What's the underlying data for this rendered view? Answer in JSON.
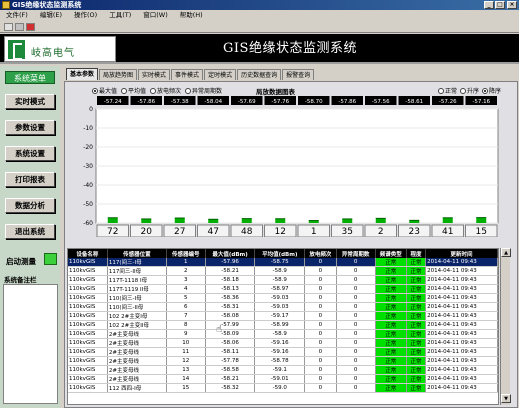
{
  "window": {
    "title": "GIS绝缘状态监测系统"
  },
  "menubar": [
    "文件(F)",
    "编辑(E)",
    "操作(O)",
    "工具(T)",
    "窗口(W)",
    "帮助(H)"
  ],
  "header": {
    "company": "岐高电气",
    "app_title": "GIS绝缘状态监测系统"
  },
  "sidebar": {
    "menu_title": "系统菜单",
    "buttons": [
      "实时模式",
      "参数设置",
      "系统设置",
      "打印报表",
      "数据分析",
      "退出系统"
    ],
    "start_label": "启动测量",
    "notes_label": "系统备注栏"
  },
  "tabs": [
    "基本参数",
    "局放趋势图",
    "实时模式",
    "事件模式",
    "定时模式",
    "历史数据查询",
    "报警查询"
  ],
  "radios": [
    "最大值",
    "平均值",
    "放电频次",
    "异常周期数"
  ],
  "sort_radios": [
    "正常",
    "升序",
    "降序"
  ],
  "chart_title": "局放数据图表",
  "chart_data": {
    "type": "bar",
    "categories": [
      "72",
      "20",
      "27",
      "47",
      "48",
      "12",
      "1",
      "35",
      "2",
      "23",
      "41",
      "15"
    ],
    "top_labels": [
      "-57.24",
      "-57.86",
      "-57.38",
      "-58.04",
      "-57.69",
      "-57.76",
      "-58.70",
      "-57.86",
      "-57.56",
      "-58.61",
      "-57.26",
      "-57.16"
    ],
    "values": [
      -57.24,
      -57.86,
      -57.38,
      -58.04,
      -57.69,
      -57.76,
      -58.7,
      -57.86,
      -57.56,
      -58.61,
      -57.26,
      -57.16
    ],
    "yticks": [
      "0",
      "-10",
      "-20",
      "-30",
      "-40",
      "-50",
      "-60"
    ],
    "ylim": [
      -60,
      0
    ],
    "bar_color": "#00b000"
  },
  "table": {
    "headers": [
      "设备名称",
      "传感器位置",
      "传感器编号",
      "最大值(dBm)",
      "平均值(dBm)",
      "放电频次",
      "异常周期数",
      "频谱类型",
      "程度",
      "更新时间"
    ],
    "rows": [
      [
        "110kvGIS",
        "117(间三-I母",
        "1",
        "-57.96",
        "-58.75",
        "0",
        "0",
        "正常",
        "正常",
        "2014-04-11 09:43"
      ],
      [
        "110kvGIS",
        "117间三-II母",
        "2",
        "-58.21",
        "-58.9",
        "0",
        "0",
        "正常",
        "正常",
        "2014-04-11 09:43"
      ],
      [
        "110kvGIS",
        "117T-1118 I母",
        "3",
        "-58.18",
        "-58.9",
        "0",
        "0",
        "正常",
        "正常",
        "2014-04-11 09:43"
      ],
      [
        "110kvGIS",
        "117T-1119 II母",
        "4",
        "-58.13",
        "-58.97",
        "0",
        "0",
        "正常",
        "正常",
        "2014-04-11 09:43"
      ],
      [
        "110kvGIS",
        "110(间三-I母",
        "5",
        "-58.36",
        "-59.03",
        "0",
        "0",
        "正常",
        "正常",
        "2014-04-11 09:43"
      ],
      [
        "110kvGIS",
        "110(间三-II母",
        "6",
        "-58.31",
        "-59.03",
        "0",
        "0",
        "正常",
        "正常",
        "2014-04-11 09:43"
      ],
      [
        "110kvGIS",
        "102 2#主变I母",
        "7",
        "-58.08",
        "-59.17",
        "0",
        "0",
        "正常",
        "正常",
        "2014-04-11 09:43"
      ],
      [
        "110kvGIS",
        "102 2#主变II母",
        "8",
        "-57.99",
        "-58.99",
        "0",
        "0",
        "正常",
        "正常",
        "2014-04-11 09:43"
      ],
      [
        "110kvGIS",
        "2#主变母线",
        "9",
        "-58.09",
        "-58.9",
        "0",
        "0",
        "正常",
        "正常",
        "2014-04-11 09:43"
      ],
      [
        "110kvGIS",
        "2#主变母线",
        "10",
        "-58.06",
        "-59.16",
        "0",
        "0",
        "正常",
        "正常",
        "2014-04-11 09:43"
      ],
      [
        "110kvGIS",
        "2#主变母线",
        "11",
        "-58.11",
        "-59.16",
        "0",
        "0",
        "正常",
        "正常",
        "2014-04-11 09:43"
      ],
      [
        "110kvGIS",
        "2#主变母线",
        "12",
        "-57.78",
        "-58.78",
        "0",
        "0",
        "正常",
        "正常",
        "2014-04-11 09:43"
      ],
      [
        "110kvGIS",
        "2#主变母线",
        "13",
        "-58.58",
        "-59.1",
        "0",
        "0",
        "正常",
        "正常",
        "2014-04-11 09:43"
      ],
      [
        "110kvGIS",
        "2#主变母线",
        "14",
        "-58.21",
        "-59.01",
        "0",
        "0",
        "正常",
        "正常",
        "2014-04-11 09:43"
      ],
      [
        "110kvGIS",
        "112 西四-I母",
        "15",
        "-58.32",
        "-59.0",
        "0",
        "0",
        "正常",
        "正常",
        "2014-04-11 09:43"
      ]
    ]
  }
}
